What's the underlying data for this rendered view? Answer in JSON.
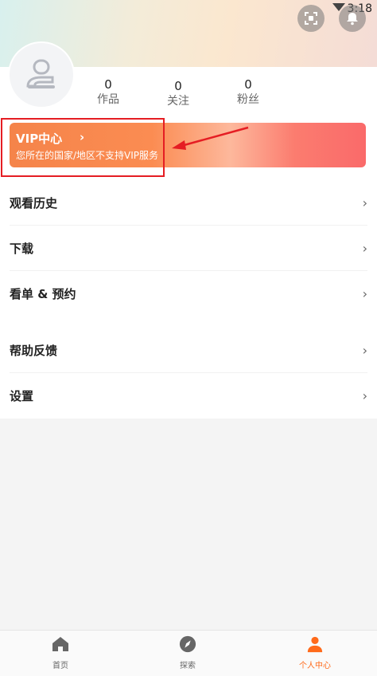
{
  "status": {
    "time": "3:18"
  },
  "profile": {
    "stats": [
      {
        "value": "0",
        "label": "作品"
      },
      {
        "value": "0",
        "label": "关注"
      },
      {
        "value": "0",
        "label": "粉丝"
      }
    ]
  },
  "vip": {
    "title": "VIP中心",
    "chevron": "›",
    "subtitle": "您所在的国家/地区不支持VIP服务"
  },
  "menu_group_1": [
    {
      "label": "观看历史"
    },
    {
      "label": "下载"
    },
    {
      "label": "看单 & 预约"
    }
  ],
  "menu_group_2": [
    {
      "label": "帮助反馈"
    },
    {
      "label": "设置"
    }
  ],
  "tabs": [
    {
      "label": "首页",
      "icon": "home-icon"
    },
    {
      "label": "探索",
      "icon": "compass-icon"
    },
    {
      "label": "个人中心",
      "icon": "person-icon",
      "active": true
    }
  ],
  "colors": {
    "accent": "#ff6a1a",
    "vip_gradient_start": "#f5844a",
    "vip_gradient_end": "#fa6a6a",
    "annotation": "#e51d23"
  }
}
